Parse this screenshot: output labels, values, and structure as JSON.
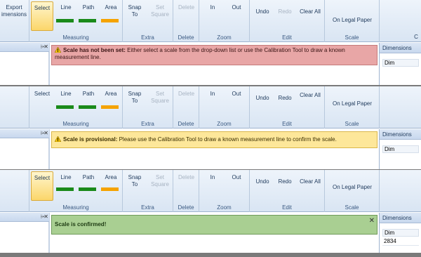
{
  "ribbon": {
    "export_label_line1": "Export",
    "export_label_line2": "imensions",
    "select_label": "Select",
    "line_label": "Line",
    "path_label": "Path",
    "area_label": "Area",
    "measuring_group": "Measuring",
    "snap_label_line1": "Snap",
    "snap_label_line2": "To",
    "set_label_line1": "Set",
    "set_label_line2": "Square",
    "extra_group": "Extra",
    "delete_label": "Delete",
    "delete_group": "Delete",
    "zoom_in_label": "In",
    "zoom_out_label": "Out",
    "zoom_group": "Zoom",
    "undo_label": "Undo",
    "redo_label": "Redo",
    "clear_all_label": "Clear All",
    "edit_group": "Edit",
    "legal_paper_label": "On Legal Paper",
    "scale_group": "Scale",
    "truncated_group": "C"
  },
  "colors": {
    "line_bar": "#1a8a1a",
    "path_bar": "#1a8a1a",
    "area_bar": "#f5a300",
    "error_bg": "#e8a6a6",
    "warning_bg": "#fde79a",
    "success_bg": "#a9cf92"
  },
  "pane": {
    "pin_icon": "pushpin",
    "close_icon": "close"
  },
  "right_panel": {
    "header": "Dimensions",
    "col_header": "Dim"
  },
  "states": [
    {
      "bold": "Scale has not been set:",
      "text": " Either select a scale from the drop-down list or use the Calibration Tool to draw a known measurement line.",
      "value": ""
    },
    {
      "bold": "Scale is provisional:",
      "text": " Please use the Calibration Tool to draw a known measurement line to confirm the scale.",
      "value": ""
    },
    {
      "bold": "Scale is confirmed!",
      "text": "",
      "value": "2834"
    }
  ]
}
